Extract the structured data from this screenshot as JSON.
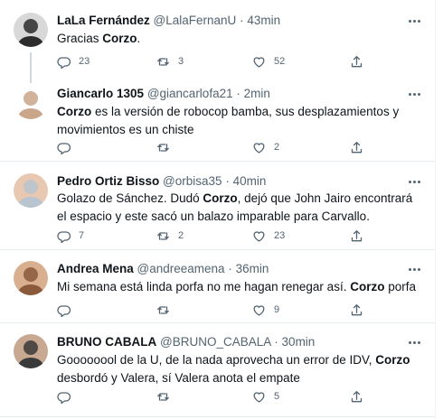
{
  "tweets": [
    {
      "name": "LaLa Fernández",
      "handle": "@LalaFernanU",
      "time": "43min",
      "sep": "·",
      "text": [
        {
          "t": "Gracias ",
          "b": false
        },
        {
          "t": "Corzo",
          "b": true
        },
        {
          "t": ".",
          "b": false
        }
      ],
      "replies": "23",
      "retweets": "3",
      "likes": "52",
      "avatar_colors": [
        "#2c2c2c",
        "#d8d8d8"
      ]
    },
    {
      "name": "Giancarlo 1305",
      "handle": "@giancarlofa21",
      "time": "2min",
      "sep": "·",
      "text": [
        {
          "t": "Corzo",
          "b": true
        },
        {
          "t": " es la versión de robocop bamba, sus desplazamientos y movimientos es un chiste",
          "b": false
        }
      ],
      "replies": "",
      "retweets": "",
      "likes": "2",
      "avatar_colors": [
        "#c9a58a",
        "#ffffff"
      ]
    },
    {
      "name": "Pedro Ortiz Bisso",
      "handle": "@orbisa35",
      "time": "40min",
      "sep": "·",
      "text": [
        {
          "t": "Golazo de Sánchez. Dudó ",
          "b": false
        },
        {
          "t": "Corzo",
          "b": true
        },
        {
          "t": ", dejó que John Jairo encontrará el espacio y este sacó un balazo imparable para Carvallo.",
          "b": false
        }
      ],
      "replies": "7",
      "retweets": "2",
      "likes": "23",
      "avatar_colors": [
        "#b8c4d0",
        "#e8c8b0"
      ]
    },
    {
      "name": "Andrea Mena",
      "handle": "@andreeamena",
      "time": "36min",
      "sep": "·",
      "text": [
        {
          "t": "Mi semana está linda porfa no me hagan renegar así. ",
          "b": false
        },
        {
          "t": "Corzo",
          "b": true
        },
        {
          "t": " porfa",
          "b": false
        }
      ],
      "replies": "",
      "retweets": "",
      "likes": "9",
      "avatar_colors": [
        "#8a5a3a",
        "#d8b090"
      ]
    },
    {
      "name": "BRUNO CABALA",
      "handle": "@BRUNO_CABALA",
      "time": "30min",
      "sep": "·",
      "text": [
        {
          "t": "Goooooool de la U, de la nada aprovecha un error de IDV, ",
          "b": false
        },
        {
          "t": "Corzo",
          "b": true
        },
        {
          "t": " desbordó y Valera, sí Valera anota el empate",
          "b": false
        }
      ],
      "replies": "",
      "retweets": "",
      "likes": "5",
      "avatar_colors": [
        "#3a3a3a",
        "#c8a890"
      ]
    }
  ],
  "colors": {
    "icon": "#536471",
    "divider": "#e6ecf0",
    "text": "#0f1419"
  }
}
